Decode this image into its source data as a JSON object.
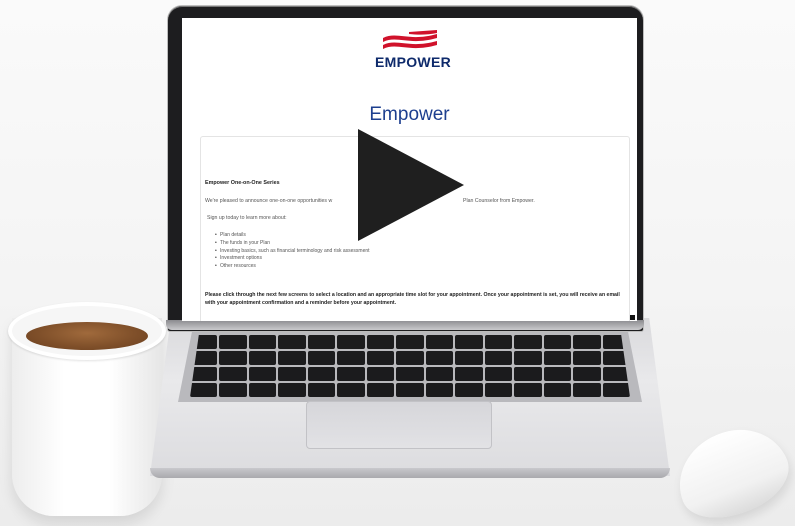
{
  "screen": {
    "logo": {
      "text": "EMPOWER",
      "colors": {
        "flag_red": "#d0122b",
        "text_navy": "#0e2a6b"
      }
    },
    "page_title": "Empower",
    "series_title": "Empower One-on-One Series",
    "announcement": {
      "text_before_overlay": "We're pleased to announce one-on-one opportunities w",
      "text_after_overlay": "Plan Counselor from Empower."
    },
    "signup_text": "Sign up today to learn more about:",
    "topics": [
      "Plan details",
      "The funds in your Plan",
      "Investing basics, such as financial terminology and risk assessment",
      "Investment options",
      "Other resources"
    ],
    "cta_text": "Please click through the next few screens to select a location and an appropriate time slot for your appointment. Once your appointment is set, you will receive an email with your appointment confirmation and a reminder before your appointment.",
    "play_icon": "play-icon"
  },
  "scene_objects": [
    "laptop",
    "coffee-mug",
    "mouse"
  ]
}
